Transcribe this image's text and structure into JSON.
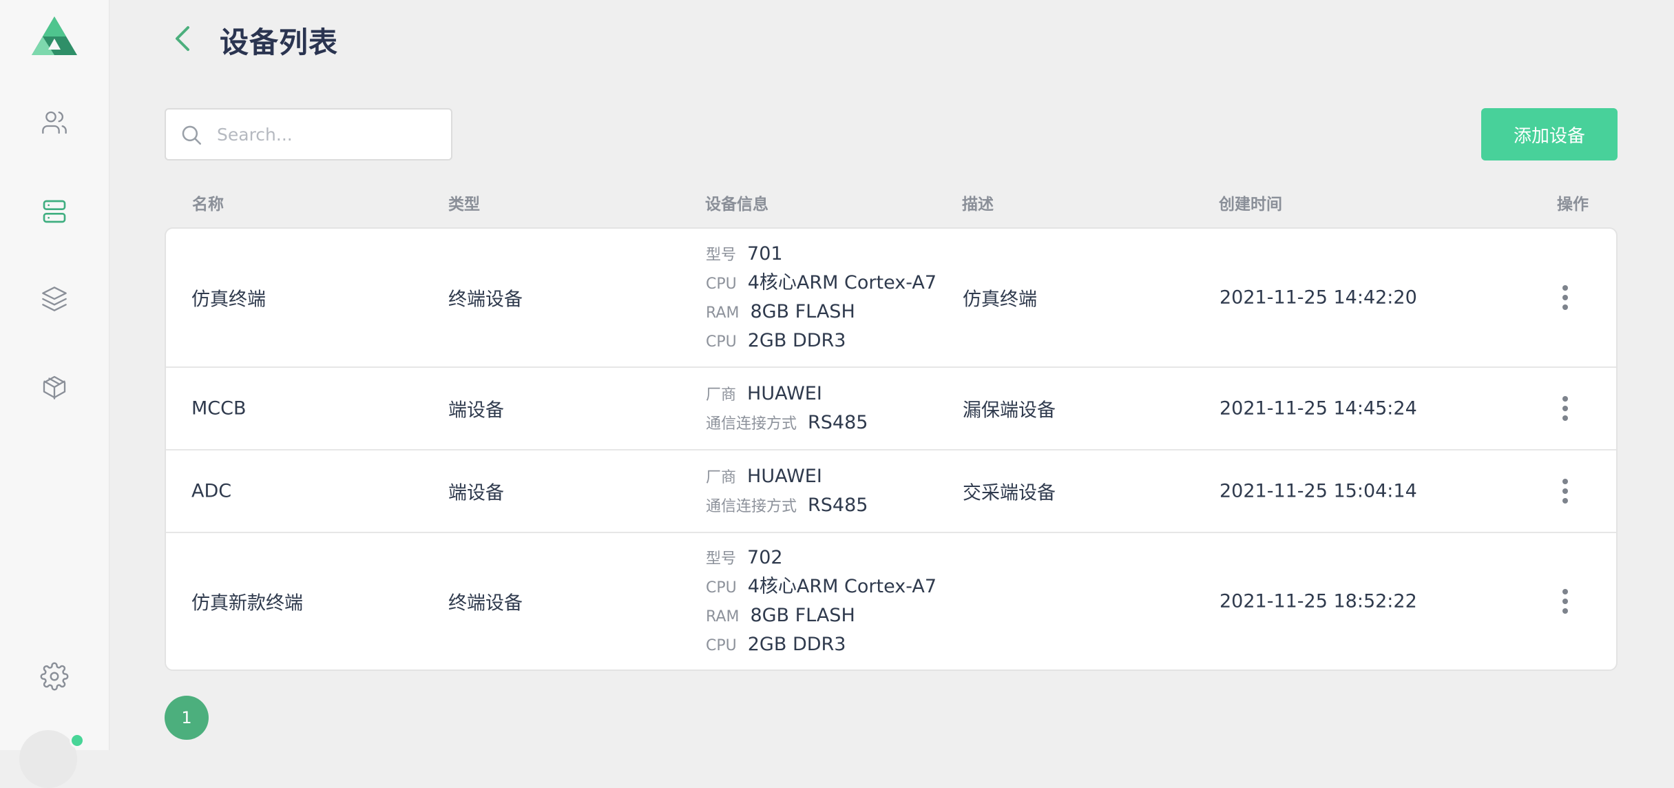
{
  "header": {
    "title": "设备列表"
  },
  "search": {
    "placeholder": "Search..."
  },
  "toolbar": {
    "add_label": "添加设备"
  },
  "columns": {
    "name": "名称",
    "type": "类型",
    "info": "设备信息",
    "desc": "描述",
    "created": "创建时间",
    "actions": "操作"
  },
  "rows": [
    {
      "name": "仿真终端",
      "type": "终端设备",
      "info": [
        {
          "key": "型号",
          "value": "701"
        },
        {
          "key": "CPU",
          "value": "4核心ARM Cortex-A7"
        },
        {
          "key": "RAM",
          "value": "8GB FLASH"
        },
        {
          "key": "CPU",
          "value": "2GB DDR3"
        }
      ],
      "desc": "仿真终端",
      "created": "2021-11-25 14:42:20"
    },
    {
      "name": "MCCB",
      "type": "端设备",
      "info": [
        {
          "key": "厂商",
          "value": "HUAWEI"
        },
        {
          "key": "通信连接方式",
          "value": "RS485"
        }
      ],
      "desc": "漏保端设备",
      "created": "2021-11-25 14:45:24"
    },
    {
      "name": "ADC",
      "type": "端设备",
      "info": [
        {
          "key": "厂商",
          "value": "HUAWEI"
        },
        {
          "key": "通信连接方式",
          "value": "RS485"
        }
      ],
      "desc": "交采端设备",
      "created": "2021-11-25 15:04:14"
    },
    {
      "name": "仿真新款终端",
      "type": "终端设备",
      "info": [
        {
          "key": "型号",
          "value": "702"
        },
        {
          "key": "CPU",
          "value": "4核心ARM Cortex-A7"
        },
        {
          "key": "RAM",
          "value": "8GB FLASH"
        },
        {
          "key": "CPU",
          "value": "2GB DDR3"
        }
      ],
      "desc": "",
      "created": "2021-11-25 18:52:22"
    }
  ],
  "pagination": {
    "current": "1"
  },
  "sidebar": {
    "icons": [
      "users-icon",
      "server-icon",
      "layers-icon",
      "box-icon",
      "gear-icon"
    ]
  },
  "colors": {
    "accent": "#48d19a",
    "page_button": "#4caf7d",
    "online": "#48d597"
  }
}
